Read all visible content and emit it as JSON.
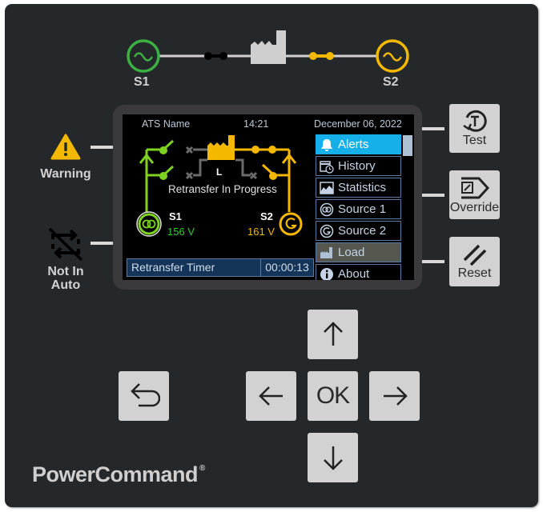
{
  "top_diagram": {
    "source1_label": "S1",
    "source2_label": "S2",
    "source1_color": "#3cb043",
    "source2_color": "#f5b800",
    "breaker1_state": "closed-inactive",
    "breaker2_state": "closed-active",
    "load_icon": "factory-icon"
  },
  "screen": {
    "ats_name": "ATS Name",
    "time": "14:21",
    "date": "December 06, 2022",
    "load_label": "L",
    "status_text": "Retransfer In Progress",
    "source1": {
      "label": "S1",
      "voltage": "156 V",
      "icon": "utility-source-icon",
      "color": "#2ecc2e"
    },
    "source2": {
      "label": "S2",
      "voltage": "161 V",
      "icon": "generator-icon",
      "color": "#f5b800"
    },
    "timer": {
      "label": "Retransfer Timer",
      "value": "00:00:13"
    },
    "menu": [
      {
        "label": "Alerts",
        "icon": "bell-icon",
        "state": "active"
      },
      {
        "label": "History",
        "icon": "calendar-clock-icon",
        "state": "normal"
      },
      {
        "label": "Statistics",
        "icon": "chart-area-icon",
        "state": "normal"
      },
      {
        "label": "Source 1",
        "icon": "utility-source-icon",
        "state": "normal"
      },
      {
        "label": "Source 2",
        "icon": "generator-icon",
        "state": "normal"
      },
      {
        "label": "Load",
        "icon": "factory-icon",
        "state": "selected"
      },
      {
        "label": "About",
        "icon": "info-icon",
        "state": "normal"
      }
    ]
  },
  "indicators": {
    "warning_label": "Warning",
    "warning_color": "#f5b800",
    "not_in_auto_label_line1": "Not In",
    "not_in_auto_label_line2": "Auto"
  },
  "buttons": {
    "test_label": "Test",
    "override_label": "Override",
    "reset_label": "Reset",
    "ok_label": "OK"
  },
  "brand": {
    "name": "PowerCommand",
    "registered": "®"
  }
}
